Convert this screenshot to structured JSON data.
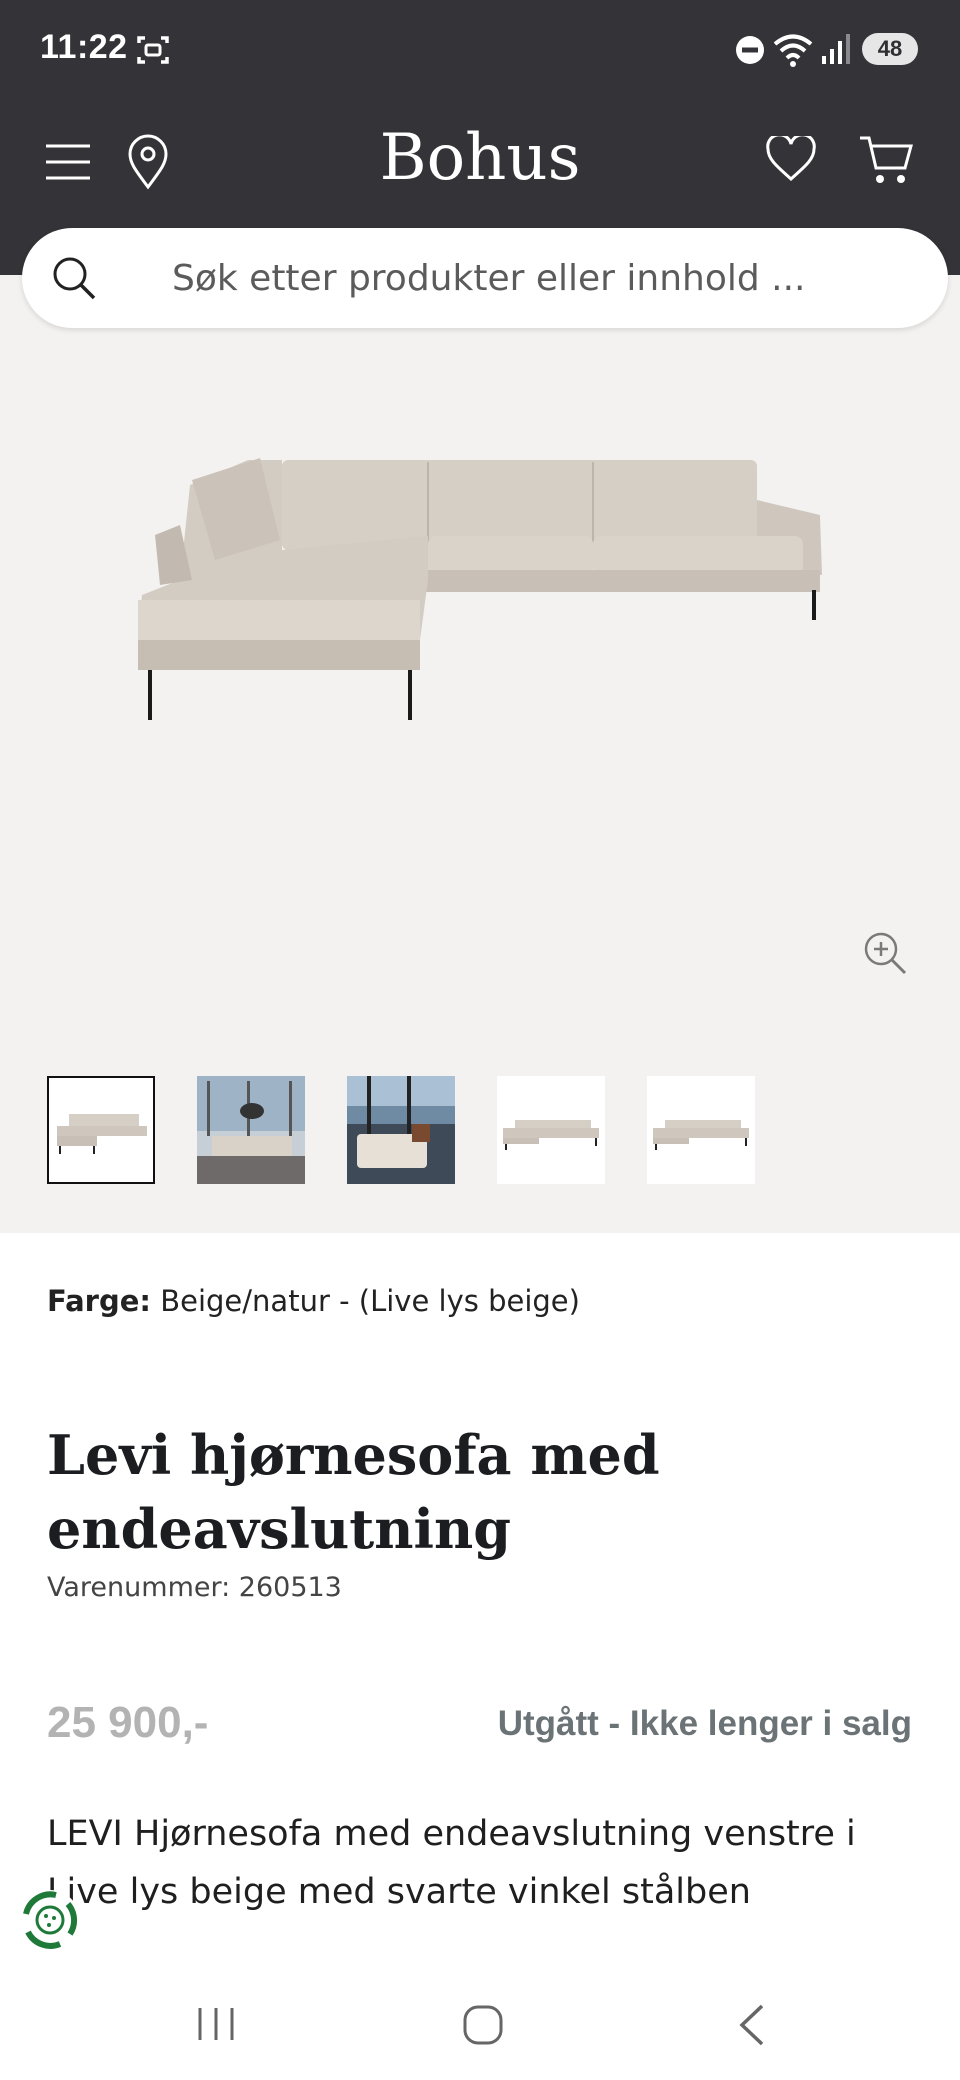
{
  "status_bar": {
    "time": "11:22",
    "battery": "48",
    "icons": [
      "screenshot-icon",
      "do-not-disturb-icon",
      "wifi-icon",
      "signal-icon"
    ]
  },
  "header": {
    "logo": "Bohus",
    "icons": [
      "menu-icon",
      "location-pin-icon",
      "heart-icon",
      "cart-icon"
    ],
    "background": "#343438"
  },
  "search": {
    "placeholder": "Søk etter produkter eller innhold ..."
  },
  "gallery": {
    "thumbnails": [
      {
        "name": "sofa-studio-view"
      },
      {
        "name": "living-room-scene"
      },
      {
        "name": "sea-view-scene"
      },
      {
        "name": "sofa-front-view"
      },
      {
        "name": "sofa-front-view-alt"
      }
    ],
    "active_index": 0
  },
  "product": {
    "color_label": "Farge:",
    "color_value": "Beige/natur - (Live lys beige)",
    "title": "Levi hjørnesofa med endeavslutning",
    "sku": "Varenummer: 260513",
    "price": "25 900,-",
    "status": "Utgått - Ikke lenger i salg",
    "description": "LEVI Hjørnesofa med endeavslutning venstre i Live lys beige med svarte vinkel stålben"
  },
  "colors": {
    "header_bg": "#343438",
    "gallery_bg": "#f4f2f0",
    "price_muted": "#b3b3b3",
    "status_text": "#6b7376",
    "sofa_fabric": "#d6cfc6"
  }
}
